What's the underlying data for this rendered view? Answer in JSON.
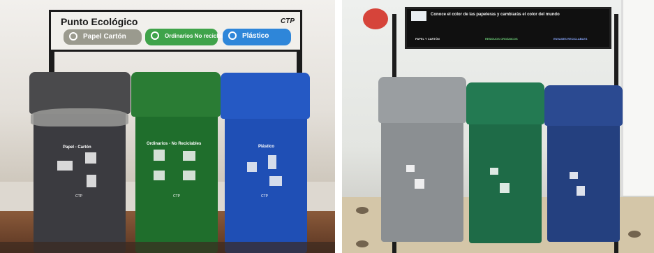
{
  "left_photo": {
    "sign": {
      "title": "Punto Ecológico",
      "logo": "CTP",
      "categories": [
        {
          "label": "Papel Cartón",
          "color": "#9a9a8e"
        },
        {
          "label": "Ordinarios No reciclables",
          "color": "#3fa34a"
        },
        {
          "label": "Plástico",
          "color": "#2e86d9"
        }
      ]
    },
    "bins": [
      {
        "label": "Papel - Cartón",
        "brand": "CTP",
        "color": "#3b3b40"
      },
      {
        "label": "Ordinarios - No Reciclables",
        "brand": "CTP",
        "color": "#1f6e2c"
      },
      {
        "label": "Plástico",
        "brand": "CTP",
        "color": "#1f4fb5"
      }
    ]
  },
  "right_photo": {
    "sign": {
      "title": "Conoce el color de las papeleras y cambiarás el color del mundo",
      "sections": [
        "PAPEL Y CARTÓN",
        "RESIDUOS ORGÁNICOS",
        "ENVASES RECICLABLES"
      ]
    },
    "bins": [
      {
        "color": "#8b8f92"
      },
      {
        "color": "#1e6b47"
      },
      {
        "color": "#24407f"
      }
    ]
  }
}
